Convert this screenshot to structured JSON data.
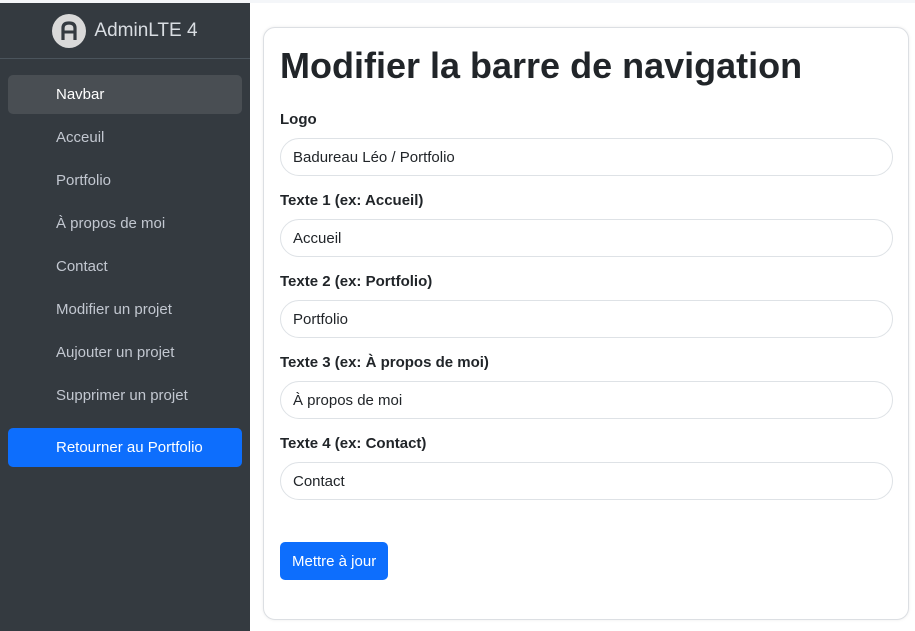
{
  "brand": {
    "name": "AdminLTE 4",
    "logo_icon": "adminlte-logo-icon"
  },
  "sidebar": {
    "items": [
      {
        "label": "Navbar",
        "active": true
      },
      {
        "label": "Acceuil"
      },
      {
        "label": "Portfolio"
      },
      {
        "label": "À propos de moi"
      },
      {
        "label": "Contact"
      },
      {
        "label": "Modifier un projet"
      },
      {
        "label": "Aujouter un projet"
      },
      {
        "label": "Supprimer un projet"
      }
    ],
    "cta_label": "Retourner au Portfolio"
  },
  "form": {
    "title": "Modifier la barre de navigation",
    "fields": [
      {
        "label": "Logo",
        "value": "Badureau Léo / Portfolio"
      },
      {
        "label": "Texte 1 (ex: Accueil)",
        "value": "Accueil"
      },
      {
        "label": "Texte 2 (ex: Portfolio)",
        "value": "Portfolio"
      },
      {
        "label": "Texte 3 (ex: À propos de moi)",
        "value": "À propos de moi"
      },
      {
        "label": "Texte 4 (ex: Contact)",
        "value": "Contact"
      }
    ],
    "submit_label": "Mettre à jour"
  },
  "colors": {
    "sidebar_bg": "#343a40",
    "active_item_bg": "#494e53",
    "primary": "#0d6efd"
  }
}
